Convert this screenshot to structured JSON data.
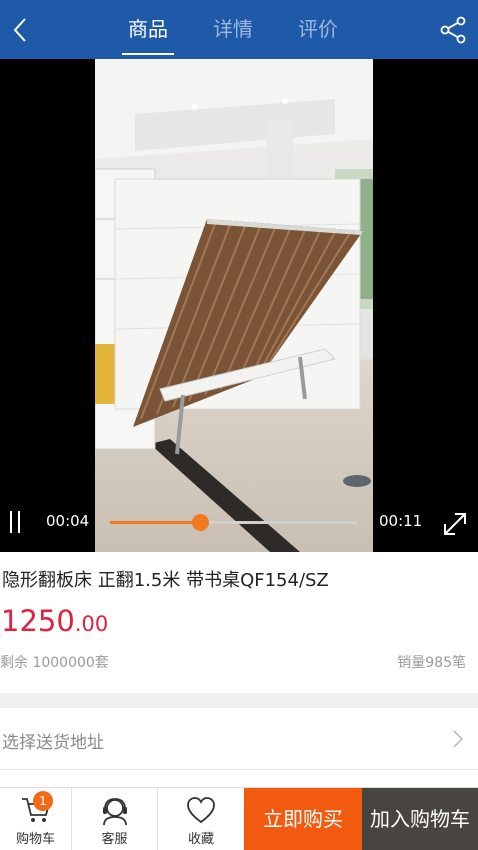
{
  "header": {
    "tabs": [
      {
        "label": "商品",
        "active": true
      },
      {
        "label": "详情",
        "active": false
      },
      {
        "label": "评价",
        "active": false
      }
    ],
    "back_icon": "chevron-left-icon",
    "share_icon": "share-icon",
    "background_color": "#1f5aa8"
  },
  "video": {
    "current_time": "00:04",
    "total_time": "00:11",
    "progress": 0.364,
    "accent_color": "#f07a1f"
  },
  "product": {
    "title": "隐形翻板床  正翻1.5米 带书桌QF154/SZ",
    "price_int": "1250",
    "price_dec": ".00",
    "stock": "剩余 1000000套",
    "sold": "销量985笔"
  },
  "address": {
    "label": "选择送货地址"
  },
  "bottom_bar": {
    "cart_label": "购物车",
    "cart_badge": "1",
    "service_label": "客服",
    "favorite_label": "收藏",
    "buy_now_label": "立即购买",
    "add_to_cart_label": "加入购物车",
    "buy_color": "#f25a0f",
    "add_color": "#484440"
  }
}
